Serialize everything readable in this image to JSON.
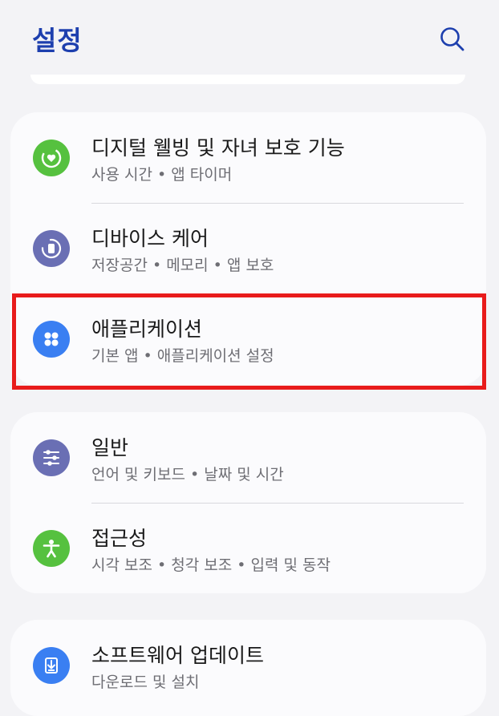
{
  "header": {
    "title": "설정",
    "search_icon": "search-icon"
  },
  "colors": {
    "title": "#1d3fae",
    "highlight": "#e81b1b",
    "digital_wellbeing": "#56c13f",
    "device_care": "#6a6fb4",
    "apps": "#3a7ff2",
    "general": "#6a6fb4",
    "accessibility": "#56c13f",
    "software_update": "#3a7ff2"
  },
  "groups": [
    {
      "items": [
        {
          "title": "디지털 웰빙 및 자녀 보호 기능",
          "subtitle": "사용 시간 • 앱 타이머",
          "icon": "heart-circle-icon"
        },
        {
          "title": "디바이스 케어",
          "subtitle": "저장공간 • 메모리 • 앱 보호",
          "icon": "device-care-icon"
        },
        {
          "title": "애플리케이션",
          "subtitle": "기본 앱 • 애플리케이션 설정",
          "icon": "apps-grid-icon"
        }
      ]
    },
    {
      "items": [
        {
          "title": "일반",
          "subtitle": "언어 및 키보드 • 날짜 및 시간",
          "icon": "sliders-icon"
        },
        {
          "title": "접근성",
          "subtitle": "시각 보조 • 청각 보조 • 입력 및 동작",
          "icon": "accessibility-icon"
        }
      ]
    },
    {
      "items": [
        {
          "title": "소프트웨어 업데이트",
          "subtitle": "다운로드 및 설치",
          "icon": "download-icon"
        }
      ]
    }
  ]
}
